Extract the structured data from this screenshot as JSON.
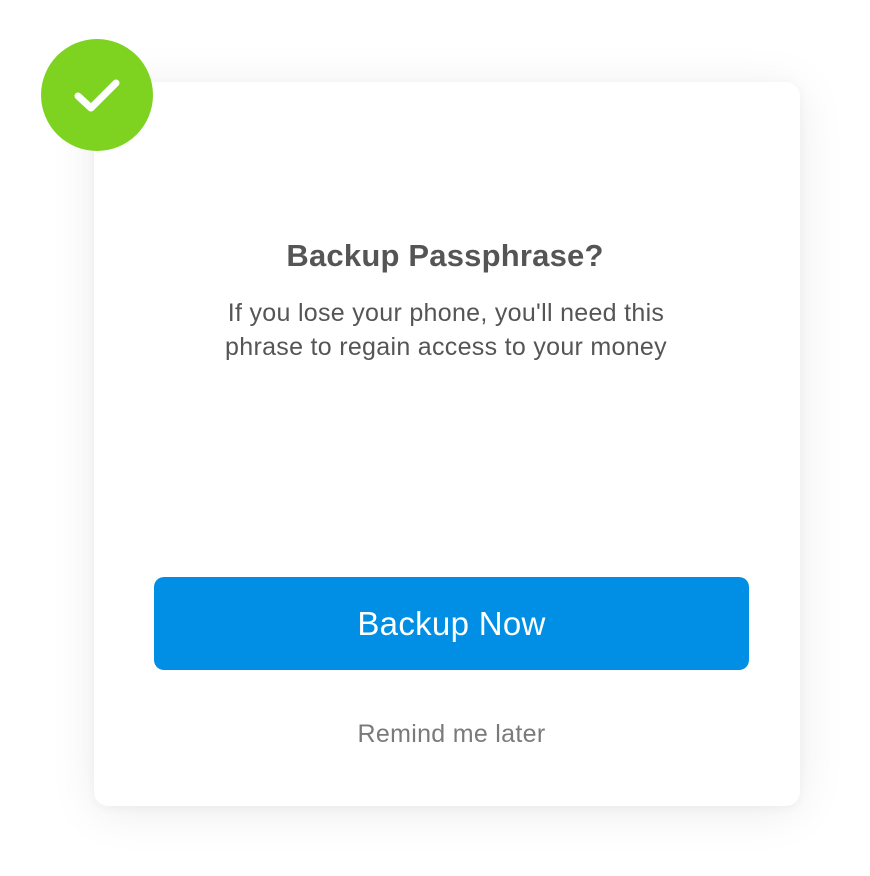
{
  "dialog": {
    "title": "Backup Passphrase?",
    "description": "If you lose your phone,  you'll need this phrase to regain access to your money",
    "primary_button_label": "Backup Now",
    "secondary_link_label": "Remind me later",
    "icon": "checkmark-icon"
  },
  "colors": {
    "success_badge": "#7ED321",
    "primary_button": "#008FE4",
    "title_text": "#555555",
    "link_text": "#7A7A7A"
  }
}
